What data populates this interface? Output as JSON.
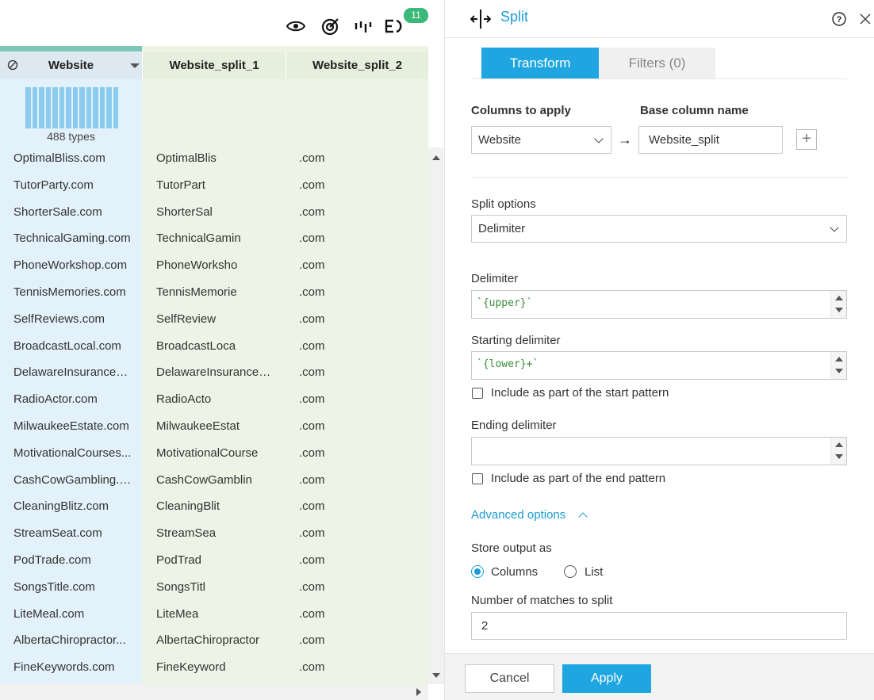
{
  "toolbar": {
    "icons": [
      "eye-icon",
      "target-icon",
      "column-stats-icon",
      "steps-icon"
    ],
    "badge": "11"
  },
  "grid": {
    "columns": [
      {
        "header": "Website"
      },
      {
        "header": "Website_split_1"
      },
      {
        "header": "Website_split_2"
      }
    ],
    "types_label": "488 types",
    "rows": [
      [
        "OptimalBliss.com",
        "OptimalBlis",
        ".com"
      ],
      [
        "TutorParty.com",
        "TutorPart",
        ".com"
      ],
      [
        "ShorterSale.com",
        "ShorterSal",
        ".com"
      ],
      [
        "TechnicalGaming.com",
        "TechnicalGamin",
        ".com"
      ],
      [
        "PhoneWorkshop.com",
        "PhoneWorksho",
        ".com"
      ],
      [
        "TennisMemories.com",
        "TennisMemorie",
        ".com"
      ],
      [
        "SelfReviews.com",
        "SelfReview",
        ".com"
      ],
      [
        "BroadcastLocal.com",
        "BroadcastLoca",
        ".com"
      ],
      [
        "DelawareInsuranceA...",
        "DelawareInsuranceA...",
        ".com"
      ],
      [
        "RadioActor.com",
        "RadioActo",
        ".com"
      ],
      [
        "MilwaukeeEstate.com",
        "MilwaukeeEstat",
        ".com"
      ],
      [
        "MotivationalCourses...",
        "MotivationalCourse",
        ".com"
      ],
      [
        "CashCowGambling.c...",
        "CashCowGamblin",
        ".com"
      ],
      [
        "CleaningBlitz.com",
        "CleaningBlit",
        ".com"
      ],
      [
        "StreamSeat.com",
        "StreamSea",
        ".com"
      ],
      [
        "PodTrade.com",
        "PodTrad",
        ".com"
      ],
      [
        "SongsTitle.com",
        "SongsTitl",
        ".com"
      ],
      [
        "LiteMeal.com",
        "LiteMea",
        ".com"
      ],
      [
        "AlbertaChiropractor...",
        "AlbertaChiropractor",
        ".com"
      ],
      [
        "FineKeywords.com",
        "FineKeyword",
        ".com"
      ]
    ]
  },
  "panel": {
    "title": "Split",
    "tabs": {
      "transform": "Transform",
      "filters": "Filters (0)"
    },
    "columns_to_apply_label": "Columns to apply",
    "columns_to_apply_value": "Website",
    "base_column_label": "Base column name",
    "base_column_value": "Website_split",
    "add_icon": "+",
    "split_options_label": "Split options",
    "split_options_value": "Delimiter",
    "delimiter_label": "Delimiter",
    "delimiter_value": "`{upper}`",
    "starting_delimiter_label": "Starting delimiter",
    "starting_delimiter_value": "`{lower}+`",
    "include_start_label": "Include as part of the start pattern",
    "ending_delimiter_label": "Ending delimiter",
    "ending_delimiter_value": "",
    "include_end_label": "Include as part of the end pattern",
    "advanced_label": "Advanced options",
    "store_output_label": "Store output as",
    "store_columns_label": "Columns",
    "store_list_label": "List",
    "store_selected": "Columns",
    "matches_label": "Number of matches to split",
    "matches_value": "2",
    "cancel_label": "Cancel",
    "apply_label": "Apply"
  },
  "colors": {
    "accent": "#1fa6e0",
    "badge": "#3cb878",
    "source_column_bg": "#e3f1fb",
    "new_column_bg": "#edf4e5"
  }
}
